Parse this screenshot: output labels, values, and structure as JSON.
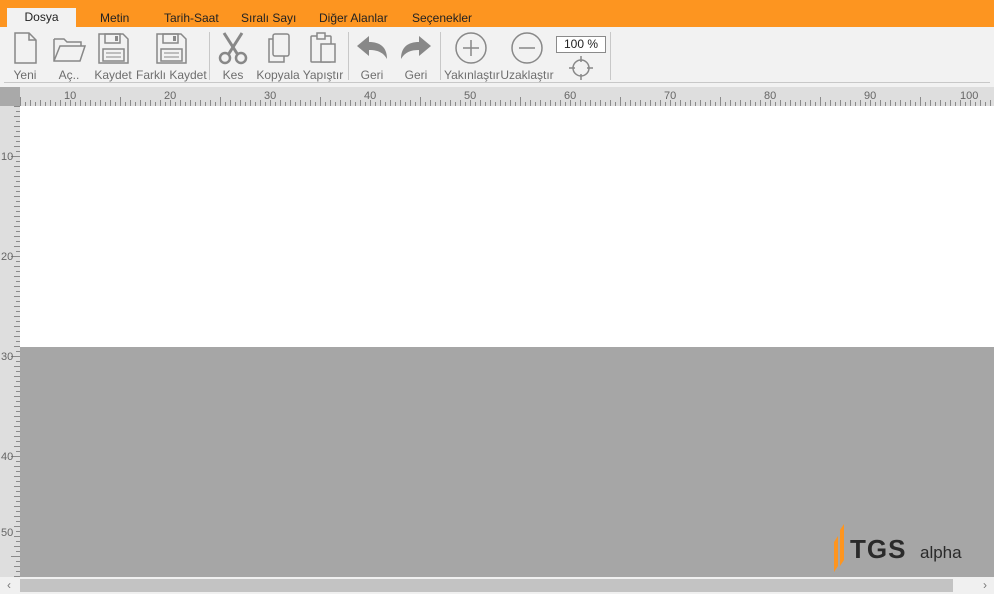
{
  "menu": {
    "tabs": [
      {
        "label": "Dosya",
        "active": true
      },
      {
        "label": "Metin"
      },
      {
        "label": "Tarih-Saat"
      },
      {
        "label": "Sıralı Sayı"
      },
      {
        "label": "Diğer Alanlar"
      },
      {
        "label": "Seçenekler"
      }
    ]
  },
  "toolbar": {
    "new": "Yeni",
    "open": "Aç..",
    "save": "Kaydet",
    "save_as": "Farklı Kaydet",
    "cut": "Kes",
    "copy": "Kopyala",
    "paste": "Yapıştır",
    "undo": "Geri",
    "redo": "Geri",
    "zoom_in": "Yakınlaştır",
    "zoom_out": "Uzaklaştır",
    "zoom_value": "100 %"
  },
  "ruler": {
    "horizontal_labels": [
      "10",
      "20",
      "30",
      "40",
      "50",
      "60",
      "70",
      "80",
      "90",
      "100"
    ],
    "vertical_labels": [
      "10",
      "20",
      "30",
      "40",
      "50"
    ]
  },
  "logo": {
    "text": "TGS",
    "suffix": "alpha",
    "accent_color": "#fd9520"
  },
  "colors": {
    "menubar": "#fd9520",
    "toolbar": "#f2f2f2",
    "workspace": "#a6a6a6",
    "canvas": "#ffffff"
  }
}
